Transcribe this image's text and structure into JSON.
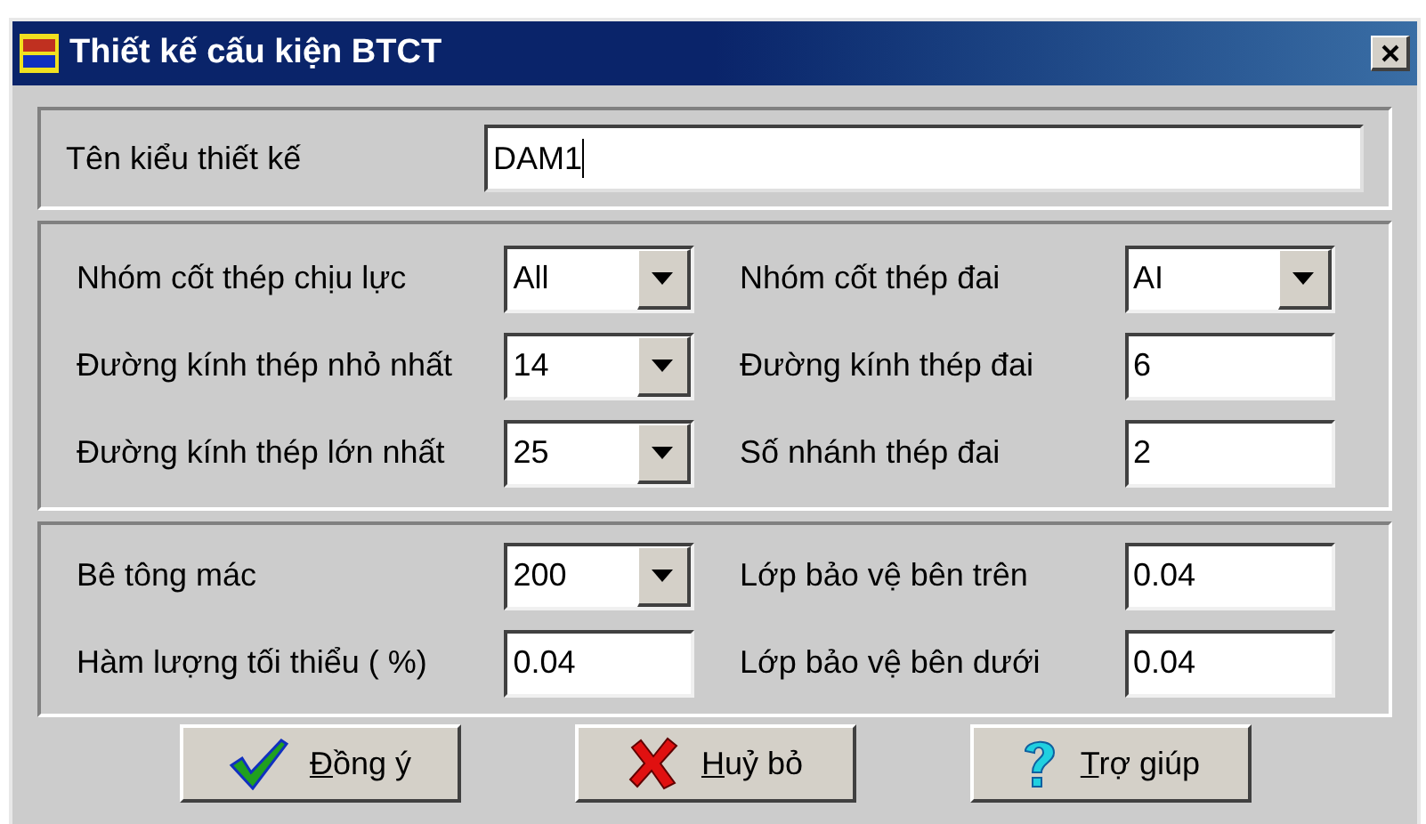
{
  "window": {
    "title": "Thiết kế cấu kiện BTCT"
  },
  "name_field": {
    "label": "Tên kiểu thiết kế",
    "value": "DAM1",
    "focused": true
  },
  "reinforcement_group": [
    {
      "label": "Nhóm cốt thép chịu lực",
      "kind": "combo",
      "value": "All"
    },
    {
      "label": "Nhóm cốt thép đai",
      "kind": "combo",
      "value": "AI"
    },
    {
      "label": "Đường kính thép nhỏ nhất",
      "kind": "combo",
      "value": "14"
    },
    {
      "label": "Đường kính thép đai",
      "kind": "text",
      "value": "6"
    },
    {
      "label": "Đường kính thép lớn nhất",
      "kind": "combo",
      "value": "25"
    },
    {
      "label": "Số nhánh thép đai",
      "kind": "text",
      "value": "2"
    }
  ],
  "concrete_group": [
    {
      "label": "Bê tông mác",
      "kind": "combo",
      "value": "200"
    },
    {
      "label": "Lớp bảo vệ bên trên",
      "kind": "text",
      "value": "0.04"
    },
    {
      "label": "Hàm lượng tối thiểu  ( %)",
      "kind": "text",
      "value": "0.04"
    },
    {
      "label": "Lớp bảo vệ  bên dưới",
      "kind": "text",
      "value": "0.04"
    }
  ],
  "buttons": [
    {
      "label": "Đồng ý",
      "kind": "ok",
      "mnemonic_first": true
    },
    {
      "label": "Huỷ bỏ",
      "kind": "cancel",
      "mnemonic_first": true
    },
    {
      "label": "Trợ giúp",
      "kind": "help",
      "mnemonic_first": true
    }
  ]
}
